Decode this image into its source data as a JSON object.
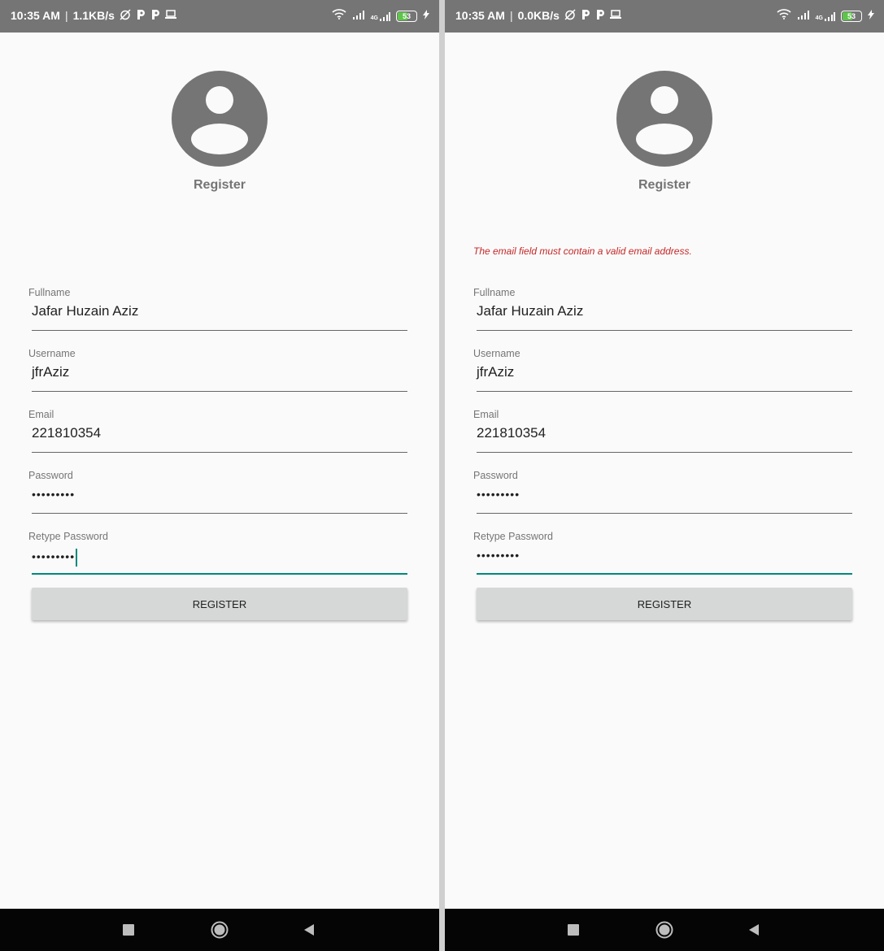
{
  "screens": [
    {
      "status": {
        "time": "10:35 AM",
        "separator": "|",
        "speed": "1.1KB/s",
        "battery": "53",
        "network": "4G"
      },
      "title": "Register",
      "error": "",
      "fields": [
        {
          "label": "Fullname",
          "value": "Jafar Huzain Aziz"
        },
        {
          "label": "Username",
          "value": "jfrAziz"
        },
        {
          "label": "Email",
          "value": "221810354"
        },
        {
          "label": "Password",
          "value": "•••••••••"
        },
        {
          "label": "Retype Password",
          "value": "•••••••••"
        }
      ],
      "button": "REGISTER"
    },
    {
      "status": {
        "time": "10:35 AM",
        "separator": "|",
        "speed": "0.0KB/s",
        "battery": "53",
        "network": "4G"
      },
      "title": "Register",
      "error": "The email field must contain a valid email address.",
      "fields": [
        {
          "label": "Fullname",
          "value": "Jafar Huzain Aziz"
        },
        {
          "label": "Username",
          "value": "jfrAziz"
        },
        {
          "label": "Email",
          "value": "221810354"
        },
        {
          "label": "Password",
          "value": "•••••••••"
        },
        {
          "label": "Retype Password",
          "value": "•••••••••"
        }
      ],
      "button": "REGISTER"
    }
  ],
  "colors": {
    "accent": "#00897b",
    "error": "#c62828",
    "statusbar": "#757575",
    "button": "#d6d7d7"
  },
  "icons": [
    "alarm-off-icon",
    "parking-icon",
    "laptop-icon",
    "wifi-icon",
    "signal-icon",
    "battery-icon",
    "charging-icon",
    "recents-icon",
    "home-icon",
    "back-icon",
    "avatar-icon"
  ]
}
